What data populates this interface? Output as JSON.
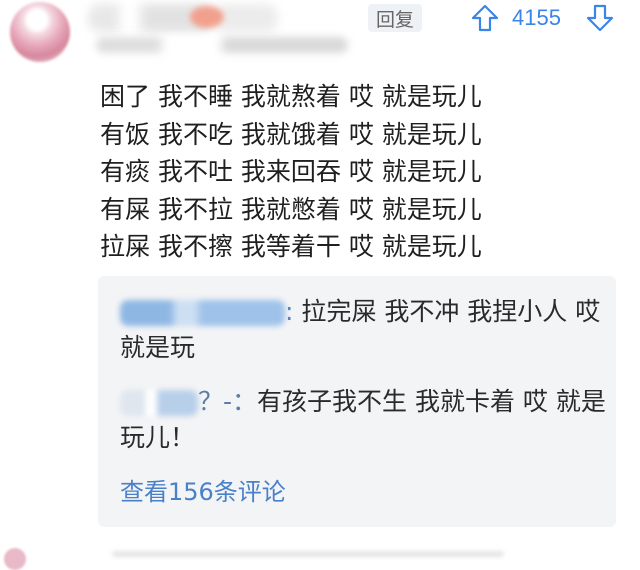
{
  "comment": {
    "reply_label": "回复",
    "vote_count": "4155",
    "lines": [
      "困了 我不睡 我就熬着 哎 就是玩儿",
      "有饭 我不吃 我就饿着 哎 就是玩儿",
      "有痰 我不吐 我来回吞 哎 就是玩儿",
      "有屎 我不拉 我就憋着 哎 就是玩儿",
      "拉屎 我不擦 我等着干 哎 就是玩儿"
    ]
  },
  "replies": [
    {
      "username_suffix": ": ",
      "text": "拉完屎 我不冲 我捏小人 哎 就是玩"
    },
    {
      "username_suffix": "？-：",
      "text": "有孩子我不生 我就卡着 哎 就是玩儿！"
    }
  ],
  "more_link_label": "查看156条评论",
  "icons": {
    "upvote": "arrow-up-icon",
    "downvote": "arrow-down-icon"
  },
  "colors": {
    "accent": "#3b84e8",
    "link": "#4a80c8",
    "reply_bg": "#f3f4f6"
  }
}
